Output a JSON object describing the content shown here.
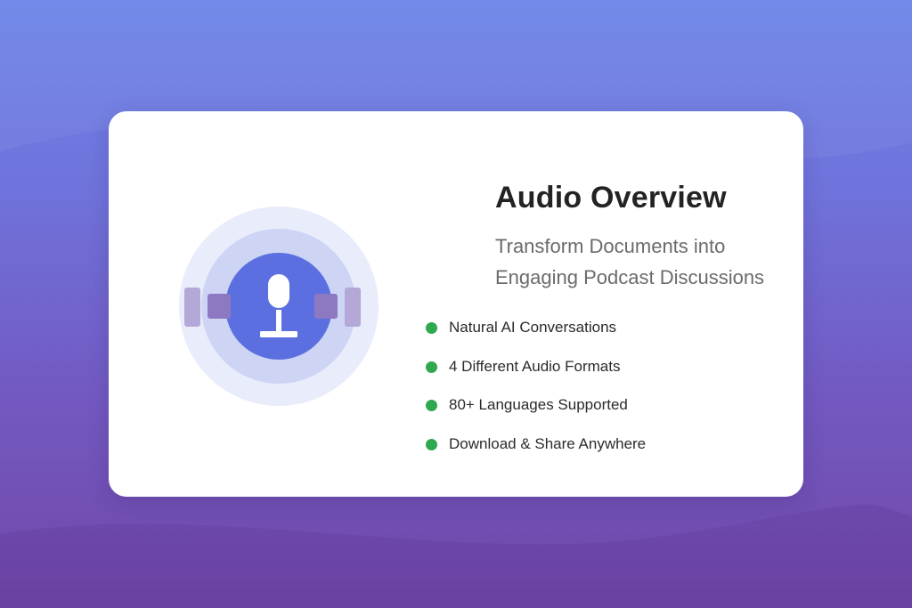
{
  "card": {
    "title": "Audio Overview",
    "subtitle": "Transform Documents into Engaging Podcast Discussions",
    "icon": "microphone-icon",
    "features": [
      {
        "label": "Natural AI Conversations",
        "icon": "green-dot-icon"
      },
      {
        "label": "4 Different Audio Formats",
        "icon": "green-dot-icon"
      },
      {
        "label": "80+ Languages Supported",
        "icon": "green-dot-icon"
      },
      {
        "label": "Download & Share Anywhere",
        "icon": "green-dot-icon"
      }
    ]
  },
  "colors": {
    "background_top": "#6b84e8",
    "background_bottom": "#7147a8",
    "accent_blue": "#5b6fe0",
    "bullet_green": "#2fa84f",
    "title_text": "#232323",
    "subtitle_text": "#6b6b6b"
  }
}
